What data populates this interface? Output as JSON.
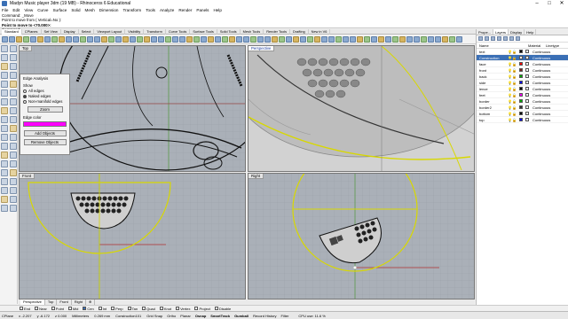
{
  "window": {
    "title": "Madyn Music player 3dm (19 MB) - Rhinoceros 6 Educational",
    "controls": [
      "–",
      "□",
      "✕"
    ]
  },
  "menu": [
    "File",
    "Edit",
    "View",
    "Curve",
    "Surface",
    "Solid",
    "Mesh",
    "Dimension",
    "Transform",
    "Tools",
    "Analyze",
    "Render",
    "Panels",
    "Help"
  ],
  "command_history": [
    "Command: _Move",
    "Point to move from ( Vertical=No ):",
    "Point to move to <70.000>:"
  ],
  "command_prompt": "Command:",
  "toolbar_tabs": [
    "Standard",
    "CPlanes",
    "Set View",
    "Display",
    "Select",
    "Viewport Layout",
    "Visibility",
    "Transform",
    "Curve Tools",
    "Surface Tools",
    "Solid Tools",
    "Mesh Tools",
    "Render Tools",
    "Drafting",
    "New in V6"
  ],
  "active_toolbar_tab": "Standard",
  "viewports": {
    "top": "Top",
    "perspective": "Perspective",
    "front": "Front",
    "right": "Right"
  },
  "viewport_tabs": [
    "Perspective",
    "Top",
    "Front",
    "Right",
    "⊕"
  ],
  "edge_analysis": {
    "title": "Edge Analysis",
    "show_label": "Show",
    "options": [
      "All edges",
      "Naked edges",
      "Non-manifold edges"
    ],
    "selected": "Naked edges",
    "zoom_button": "Zoom",
    "edge_color_label": "Edge color",
    "edge_color": "#ff00ff",
    "add_button": "Add Objects",
    "remove_button": "Remove Objects"
  },
  "right_panel": {
    "tabs": [
      "Prope...",
      "Layers",
      "Display",
      "Help"
    ],
    "active_tab": "Layers",
    "columns": {
      "name": "Name",
      "material": "Material",
      "linetype": "Linetype"
    },
    "layers": [
      {
        "name": "text",
        "color": "#000000",
        "linetype": "Continuous",
        "current": false
      },
      {
        "name": "Construction",
        "color": "#ffffff",
        "linetype": "Continuous",
        "current": true
      },
      {
        "name": "face",
        "color": "#ff0000",
        "linetype": "Continuous",
        "current": false
      },
      {
        "name": "front",
        "color": "#7a1f1f",
        "linetype": "Continuous",
        "current": false
      },
      {
        "name": "back",
        "color": "#00aa00",
        "linetype": "Continuous",
        "current": false
      },
      {
        "name": "side",
        "color": "#0000ff",
        "linetype": "Continuous",
        "current": false
      },
      {
        "name": "lence",
        "color": "#000000",
        "linetype": "Continuous",
        "current": false
      },
      {
        "name": "feet",
        "color": "#ff00ff",
        "linetype": "Continuous",
        "current": false
      },
      {
        "name": "border",
        "color": "#00aa00",
        "linetype": "Continuous",
        "current": false
      },
      {
        "name": "border2",
        "color": "#333333",
        "linetype": "Continuous",
        "current": false
      },
      {
        "name": "bottom",
        "color": "#000000",
        "linetype": "Continuous",
        "current": false
      },
      {
        "name": "top",
        "color": "#0000ff",
        "linetype": "Continuous",
        "current": false
      }
    ]
  },
  "osnaps": [
    {
      "label": "End",
      "on": false
    },
    {
      "label": "Near",
      "on": false
    },
    {
      "label": "Point",
      "on": false
    },
    {
      "label": "Mid",
      "on": false
    },
    {
      "label": "Cen",
      "on": true
    },
    {
      "label": "Int",
      "on": false
    },
    {
      "label": "Perp",
      "on": false
    },
    {
      "label": "Tan",
      "on": false
    },
    {
      "label": "Quad",
      "on": false
    },
    {
      "label": "Knot",
      "on": false
    },
    {
      "label": "Vertex",
      "on": false
    },
    {
      "label": "Project",
      "on": false
    },
    {
      "label": "Disable",
      "on": false
    }
  ],
  "status": {
    "cplane": "CPlane",
    "x": "x -2.207",
    "y": "y -6.172",
    "z": "z 0.000",
    "units": "Millimeters",
    "distance": "0.269 mm",
    "layer": "Construction101",
    "toggles": [
      "Grid Snap",
      "Ortho",
      "Planar",
      "Osnap",
      "SmartTrack",
      "Gumball",
      "Record History",
      "Filter"
    ],
    "bold_toggles": [
      "Osnap",
      "SmartTrack",
      "Gumball"
    ],
    "cpu": "CPU use: 11.6 %"
  }
}
